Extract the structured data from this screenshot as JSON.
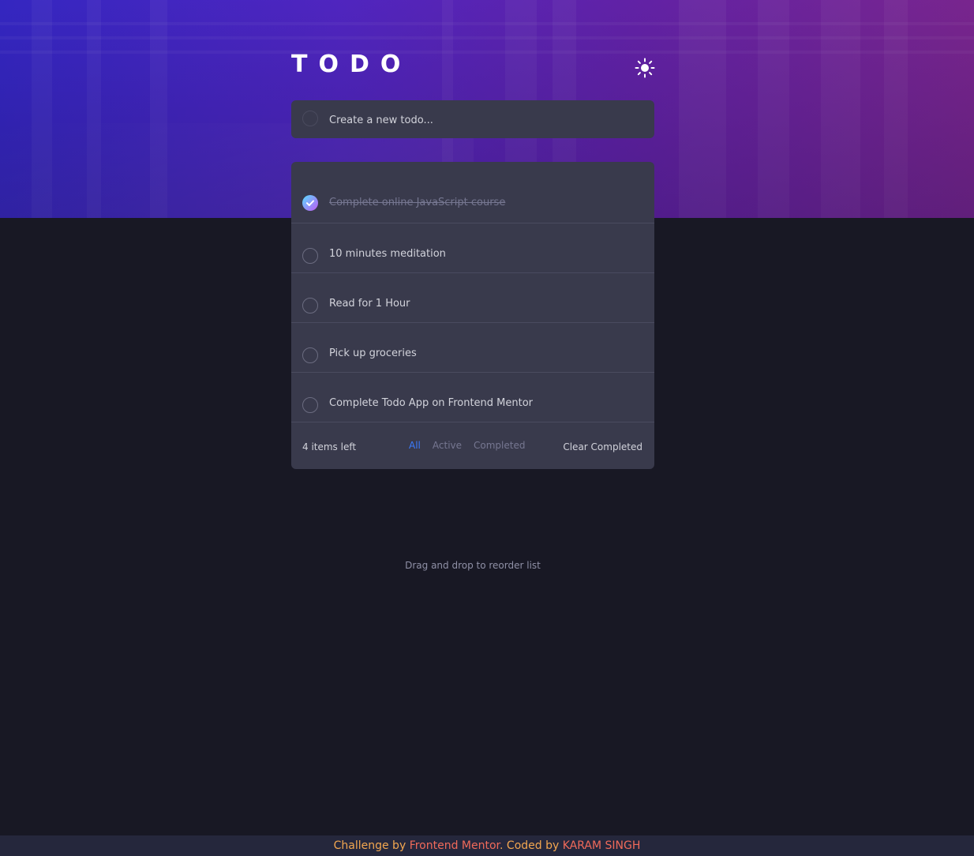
{
  "app": {
    "title": "TODO",
    "theme_icon": "sun-icon"
  },
  "create": {
    "placeholder": "Create a new todo..."
  },
  "todos": [
    {
      "label": "Complete online JavaScript course",
      "completed": true
    },
    {
      "label": "10 minutes meditation",
      "completed": false
    },
    {
      "label": "Read for 1 Hour",
      "completed": false
    },
    {
      "label": "Pick up groceries",
      "completed": false
    },
    {
      "label": "Complete Todo App on Frontend Mentor",
      "completed": false
    }
  ],
  "footer": {
    "items_left": "4 items left",
    "filters": {
      "all": "All",
      "active": "Active",
      "completed": "Completed"
    },
    "active_filter": "All",
    "clear_completed": "Clear Completed"
  },
  "hint": "Drag and drop to reorder list",
  "attribution": {
    "prefix": "Challenge by ",
    "frontend_mentor": "Frontend Mentor",
    "middle": ". Coded by ",
    "author": "KARAM SINGH"
  },
  "colors": {
    "accent": "#3a7bfd",
    "check_gradient_start": "#57ddff",
    "check_gradient_end": "#c058f3",
    "card": "#393a4c",
    "background": "#181824"
  }
}
